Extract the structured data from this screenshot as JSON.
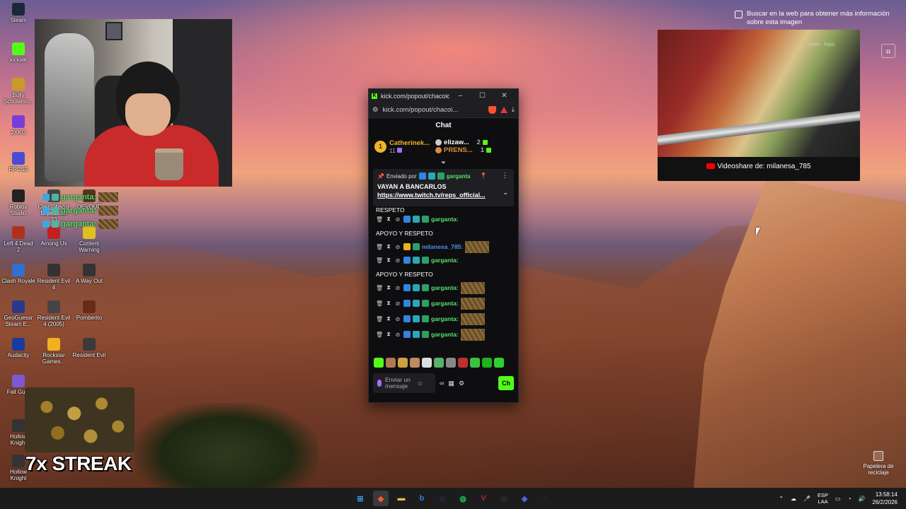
{
  "desktop": {
    "icons": [
      {
        "label": "Steam",
        "icon": "steam-icon",
        "color": "#1b2838"
      },
      {
        "label": "kickalk",
        "icon": "kick-icon",
        "color": "#53fc18"
      },
      {
        "label": "Bully Scholarsh...",
        "icon": "bully-icon",
        "color": "#c79a2a"
      },
      {
        "label": "2XKO",
        "icon": "2xko-icon",
        "color": "#7a3cd6"
      },
      {
        "label": "RPCS3",
        "icon": "rpcs3-icon",
        "color": "#4b4bd6"
      },
      {
        "label": "Roblox Studio",
        "icon": "roblox-icon",
        "color": "#222222"
      },
      {
        "label": "Clair Obscur Expedition 33",
        "icon": "clair-icon",
        "color": "#444444"
      },
      {
        "label": "DEVOUR",
        "icon": "devour-icon",
        "color": "#553322"
      },
      {
        "label": "Left 4 Dead 2",
        "icon": "l4d2-icon",
        "color": "#b03020"
      },
      {
        "label": "Among Us",
        "icon": "amongus-icon",
        "color": "#c02020"
      },
      {
        "label": "Content Warning",
        "icon": "contentwarning-icon",
        "color": "#e0c020"
      },
      {
        "label": "Clash Royale",
        "icon": "clashroyale-icon",
        "color": "#3070d0"
      },
      {
        "label": "Resident Evil 4",
        "icon": "re4-icon",
        "color": "#333333"
      },
      {
        "label": "A Way Out",
        "icon": "awayout-icon",
        "color": "#333333"
      },
      {
        "label": "GeoGuessr Steam E...",
        "icon": "geoguessr-icon",
        "color": "#2a3a8a"
      },
      {
        "label": "Resident Evil 4 (2005)",
        "icon": "re4-2005-icon",
        "color": "#444444"
      },
      {
        "label": "Pomberito",
        "icon": "pomberito-icon",
        "color": "#6a2a1a"
      },
      {
        "label": "Audacity",
        "icon": "audacity-icon",
        "color": "#1a3aa0"
      },
      {
        "label": "Rockstar Games...",
        "icon": "rockstar-icon",
        "color": "#f0b020"
      },
      {
        "label": "Resident Evil",
        "icon": "re-icon",
        "color": "#3a3a3a"
      },
      {
        "label": "Fall Gu...",
        "icon": "fallguys-icon",
        "color": "#7a5ad0"
      },
      {
        "label": "Hollow Knight",
        "icon": "hollowknight-icon",
        "color": "#333333"
      },
      {
        "label": "Hollow Knight",
        "icon": "hollowknight2-icon",
        "color": "#333333"
      }
    ],
    "recycle_bin": "Papelera de reciclaje"
  },
  "stream_overlay": {
    "chat_user": "garganta:",
    "streak_text": "7x STREAK",
    "video_caption": "Videoshare de: milanesa_785",
    "video_topic": "millet - Topic"
  },
  "lens": {
    "tooltip": "Buscar en la web para obtener más información sobre esta imagen"
  },
  "popup": {
    "window_title": "kick.com/popout/chacoide/...",
    "url": "kick.com/popout/chacoi...",
    "chat_header": "Chat",
    "gifters": {
      "first": {
        "rank": "1",
        "name": "Catherinek...",
        "count": "11"
      },
      "second": {
        "name": "elizaw...",
        "count": "2"
      },
      "third": {
        "name": "PRENS...",
        "count": "1"
      }
    },
    "pinned": {
      "sent_by_label": "Enviado por",
      "sent_by_user": "garganta",
      "message": "VAYAN A BANCARLOS",
      "link": "https://www.twitch.tv/reps_official..."
    },
    "continued_text": "RESPETO",
    "messages": [
      {
        "user": "garganta:",
        "text": "APOYO Y RESPETO",
        "emote": false
      },
      {
        "user": "milanesa_785:",
        "text": "",
        "emote": true,
        "blue": true
      },
      {
        "user": "garganta:",
        "text": "APOYO Y RESPETO",
        "emote": false
      },
      {
        "user": "garganta:",
        "text": "",
        "emote": true
      },
      {
        "user": "garganta:",
        "text": "",
        "emote": true
      },
      {
        "user": "garganta:",
        "text": "",
        "emote": true
      },
      {
        "user": "garganta:",
        "text": "",
        "emote": true
      }
    ],
    "input_placeholder": "Enviar un mensaje",
    "send_label": "Ch"
  },
  "taskbar": {
    "apps": [
      "windows-start",
      "brave",
      "file-explorer",
      "bing",
      "steam",
      "spotify",
      "voicemeeter",
      "obs",
      "discord",
      "app-a"
    ],
    "lang": "ESP",
    "lang_sub": "LAA",
    "time": "13:58:14",
    "date": "26/2/2026"
  }
}
